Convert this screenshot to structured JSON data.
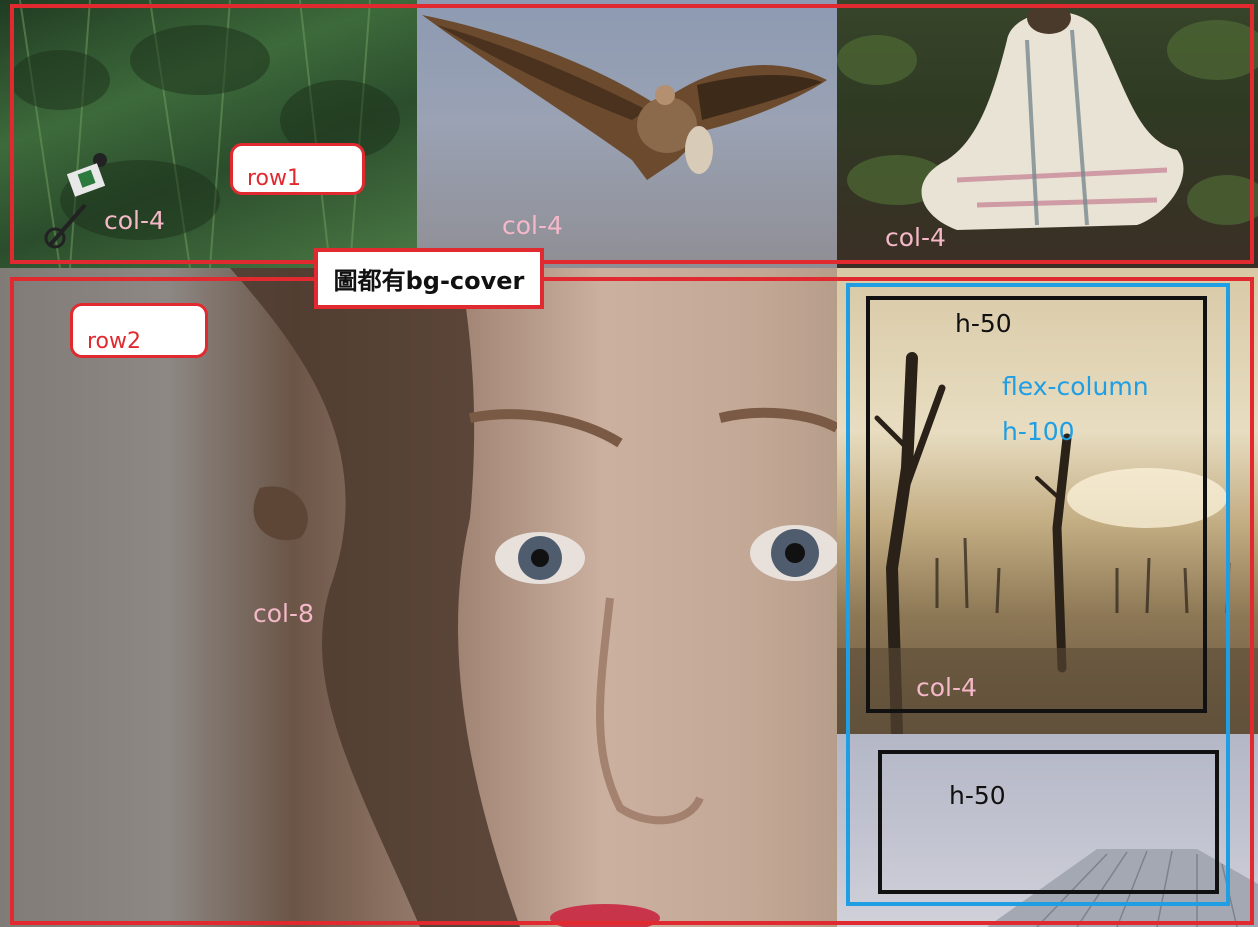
{
  "labels": {
    "row1": "row1",
    "row2": "row2",
    "cover_note": "圖都有bg-cover",
    "col4_forest": "col-4",
    "col4_vulture": "col-4",
    "col4_dog": "col-4",
    "col8_face": "col-8",
    "col4_desert": "col-4",
    "h50_top": "h-50",
    "h50_bottom": "h-50",
    "flex_column": "flex-column",
    "h100": "h-100"
  },
  "colors": {
    "row_border": "#e12a2f",
    "flex_border": "#1f9ee3",
    "h50_border": "#111111",
    "col_label": "#f4b8c8"
  },
  "photos": [
    {
      "id": "forest",
      "icon": "forest-biker-photo"
    },
    {
      "id": "vulture",
      "icon": "vulture-photo"
    },
    {
      "id": "dog",
      "icon": "blanket-dog-photo"
    },
    {
      "id": "face",
      "icon": "woman-face-photo"
    },
    {
      "id": "desert",
      "icon": "dead-trees-photo"
    },
    {
      "id": "sky",
      "icon": "sky-building-photo"
    }
  ]
}
